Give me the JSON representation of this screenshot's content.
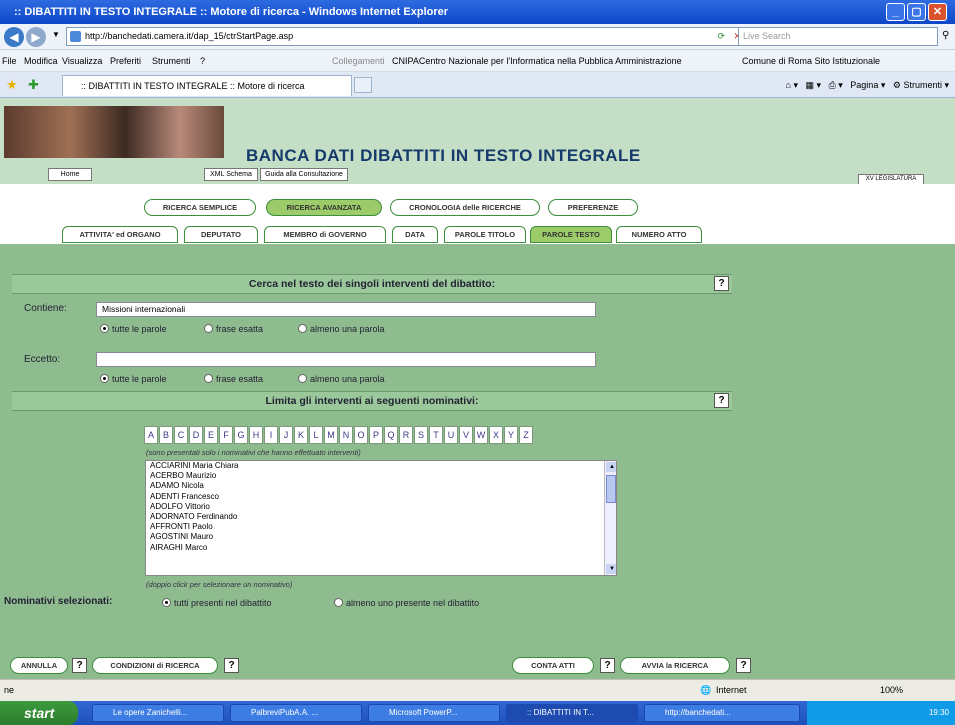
{
  "window": {
    "title": ":: DIBATTITI IN TESTO INTEGRALE :: Motore di ricerca - Windows Internet Explorer"
  },
  "browser": {
    "url": "http://banchedati.camera.it/dap_15/ctrStartPage.asp",
    "search_placeholder": "Live Search",
    "menu": [
      "File",
      "Modifica",
      "Visualizza",
      "Preferiti",
      "Strumenti",
      "?"
    ],
    "links_label": "Collegamenti",
    "links": [
      "CNIPACentro Nazionale per l'Informatica nella Pubblica Amministrazione",
      "Comune di Roma Sito Istituzionale"
    ],
    "tab_label": ":: DIBATTITI IN TESTO INTEGRALE :: Motore di ricerca",
    "tools": [
      "Pagina",
      "Strumenti"
    ]
  },
  "banner": {
    "title": "BANCA DATI DIBATTITI IN TESTO INTEGRALE",
    "home": "Home",
    "xml": "XML Schema",
    "guide": "Guida alla Consultazione",
    "legislature": "XV LEGISLATURA"
  },
  "search_modes": [
    "RICERCA SEMPLICE",
    "RICERCA AVANZATA",
    "CRONOLOGIA delle RICERCHE",
    "PREFERENZE"
  ],
  "criteria_tabs": [
    "ATTIVITA' ed ORGANO",
    "DEPUTATO",
    "MEMBRO di GOVERNO",
    "DATA",
    "PAROLE TITOLO",
    "PAROLE TESTO",
    "NUMERO ATTO"
  ],
  "form": {
    "section1_title": "Cerca nel testo dei singoli interventi del dibattito:",
    "contains_label": "Contiene:",
    "contains_value": "Missioni internazionali",
    "except_label": "Eccetto:",
    "except_value": "",
    "radio_options": [
      "tutte le parole",
      "frase esatta",
      "almeno una parola"
    ],
    "section2_title": "Limita gli interventi ai seguenti nominativi:",
    "alphabet": [
      "A",
      "B",
      "C",
      "D",
      "E",
      "F",
      "G",
      "H",
      "I",
      "J",
      "K",
      "L",
      "M",
      "N",
      "O",
      "P",
      "Q",
      "R",
      "S",
      "T",
      "U",
      "V",
      "W",
      "X",
      "Y",
      "Z"
    ],
    "list_note": "(sono presentati solo i nominativi che hanno effettuato interventi)",
    "names": [
      "ACCIARINI Maria Chiara",
      "ACERBO Maurizio",
      "ADAMO Nicola",
      "ADENTI Francesco",
      "ADOLFO Vittorio",
      "ADORNATO Ferdinando",
      "AFFRONTI Paolo",
      "AGOSTINI Mauro",
      "AIRAGHI Marco"
    ],
    "dblclick_note": "(doppio click per selezionare un nominativo)",
    "selected_label": "Nominativi selezionati:",
    "selected_options": [
      "tutti presenti nel dibattito",
      "almeno uno presente nel dibattito"
    ],
    "help": "?"
  },
  "footer": {
    "cancel": "ANNULLA",
    "conditions": "CONDIZIONI di RICERCA",
    "count": "CONTA ATTI",
    "run": "AVVIA la RICERCA"
  },
  "statusbar": {
    "zone": "Internet",
    "zoom": "100%"
  },
  "taskbar": {
    "start": "start",
    "tasks": [
      "Le opere Zanichelli...",
      "PalbreviPubA.A. ...",
      "Microsoft PowerP...",
      ":: DIBATTITI IN T...",
      "http://banchedati..."
    ],
    "clock": "19:30"
  }
}
